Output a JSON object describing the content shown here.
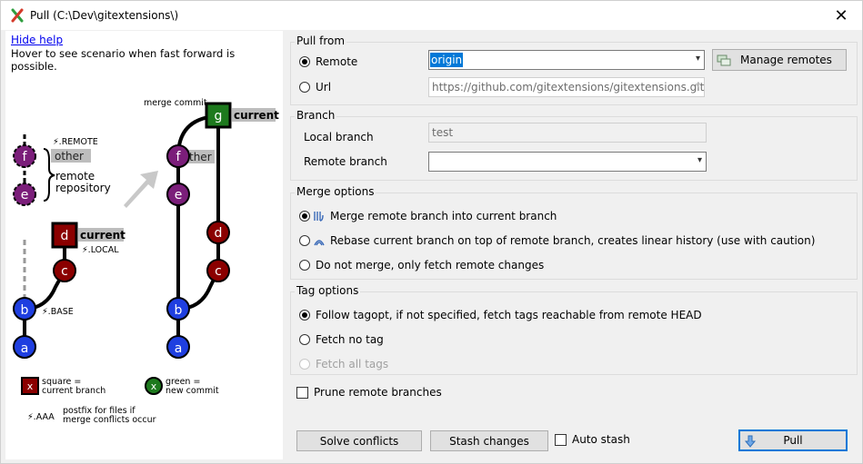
{
  "window": {
    "title": "Pull (C:\\Dev\\gitextensions\\)"
  },
  "help": {
    "hide_help": "Hide help",
    "hover_text": "Hover to see scenario when fast forward is possible.",
    "diagram": {
      "merge_commit": "merge commit",
      "remote_marker": "⚡.REMOTE",
      "other_tag": "other",
      "other_tag_partial": "ther",
      "remote_repository_1": "remote",
      "remote_repository_2": "repository",
      "current_tag": "current",
      "local_marker": "⚡.LOCAL",
      "base_marker": "⚡.BASE",
      "nodes": {
        "a": "a",
        "b": "b",
        "c": "c",
        "d": "d",
        "e": "e",
        "f": "f",
        "g": "g"
      },
      "legend": {
        "square_symbol": "x",
        "square_line1": "square =",
        "square_line2": "current branch",
        "green_symbol": "x",
        "green_line1": "green =",
        "green_line2": "new commit",
        "postfix_symbol": "⚡.AAA",
        "postfix_line1": "postfix for files if",
        "postfix_line2": "merge conflicts occur"
      }
    }
  },
  "pull_from": {
    "label": "Pull from",
    "remote_label": "Remote",
    "remote_value": "origin",
    "manage_remotes": "Manage remotes",
    "url_label": "Url",
    "url_value": "https://github.com/gitextensions/gitextensions.git"
  },
  "branch": {
    "label": "Branch",
    "local_label": "Local branch",
    "local_value": "test",
    "remote_label": "Remote branch",
    "remote_value": ""
  },
  "merge_options": {
    "label": "Merge options",
    "merge": "Merge remote branch into current branch",
    "rebase": "Rebase current branch on top of remote branch, creates linear history (use with caution)",
    "fetch": "Do not merge, only fetch remote changes"
  },
  "tag_options": {
    "label": "Tag options",
    "follow": "Follow tagopt, if not specified, fetch tags reachable from remote HEAD",
    "no_tag": "Fetch no tag",
    "all_tags": "Fetch all tags"
  },
  "prune": "Prune remote branches",
  "footer": {
    "solve_conflicts": "Solve conflicts",
    "stash_changes": "Stash changes",
    "auto_stash": "Auto stash",
    "pull": "Pull"
  },
  "colors": {
    "purple": "#7b1e7a",
    "darkred": "#8b0000",
    "blue": "#1f3fe0",
    "green": "#1e7a1e",
    "accent": "#0078d7"
  }
}
